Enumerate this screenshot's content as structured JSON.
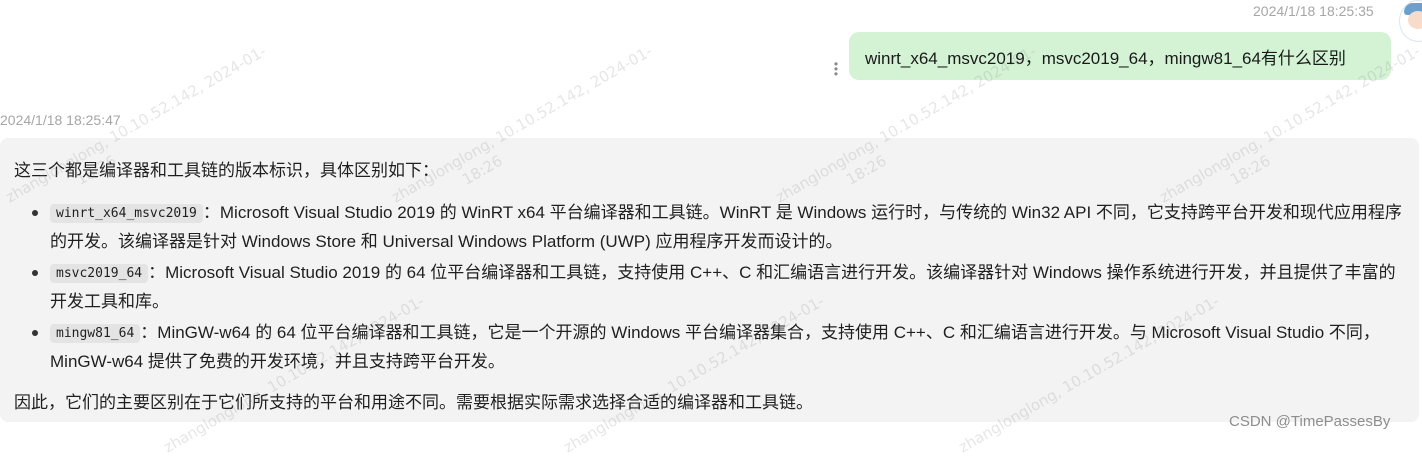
{
  "user_message": {
    "timestamp": "2024/1/18 18:25:35",
    "text": "winrt_x64_msvc2019，msvc2019_64，mingw81_64有什么区别"
  },
  "bot_message": {
    "timestamp": "2024/1/18 18:25:47",
    "intro": "这三个都是编译器和工具链的版本标识，具体区别如下：",
    "items": [
      {
        "code": "winrt_x64_msvc2019",
        "text": "：Microsoft Visual Studio 2019 的 WinRT x64 平台编译器和工具链。WinRT 是 Windows 运行时，与传统的 Win32 API 不同，它支持跨平台开发和现代应用程序的开发。该编译器是针对 Windows Store 和 Universal Windows Platform (UWP) 应用程序开发而设计的。"
      },
      {
        "code": "msvc2019_64",
        "text": "：Microsoft Visual Studio 2019 的 64 位平台编译器和工具链，支持使用 C++、C 和汇编语言进行开发。该编译器针对 Windows 操作系统进行开发，并且提供了丰富的开发工具和库。"
      },
      {
        "code": "mingw81_64",
        "text": "：MinGW-w64 的 64 位平台编译器和工具链，它是一个开源的 Windows 平台编译器集合，支持使用 C++、C 和汇编语言进行开发。与 Microsoft Visual Studio 不同，MinGW-w64 提供了免费的开发环境，并且支持跨平台开发。"
      }
    ],
    "summary": "因此，它们的主要区别在于它们所支持的平台和用途不同。需要根据实际需求选择合适的编译器和工具链。"
  },
  "watermark": {
    "line1": "zhanglonglong, 10.10.52.142, 2024-01-",
    "line2": "18:26"
  },
  "source_mark": "CSDN @TimePassesBy",
  "colors": {
    "user_bubble": "#d3f3d4",
    "bot_card": "#f3f3f3",
    "timestamp": "#a6a6a6"
  },
  "icons": {
    "avatar": "user-avatar",
    "more": "vertical-dots-icon"
  }
}
